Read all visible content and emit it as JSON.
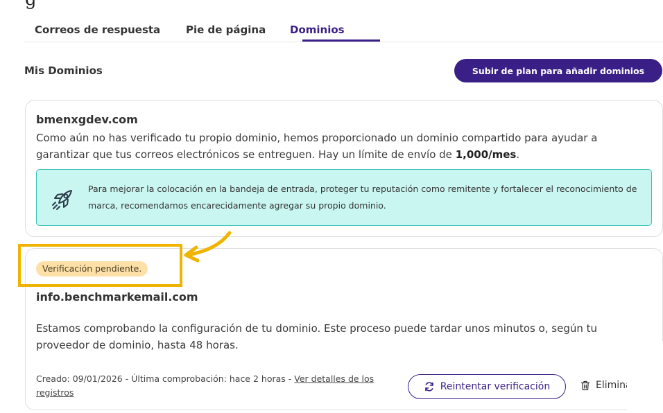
{
  "tabs": [
    {
      "label": "Correos de respuesta",
      "active": false
    },
    {
      "label": "Pie de página",
      "active": false
    },
    {
      "label": "Dominios",
      "active": true
    }
  ],
  "section": {
    "title": "Mis Dominios",
    "upgrade_button": "Subir de plan para añadir dominios"
  },
  "shared_domain": {
    "name": "bmenxgdev.com",
    "description": "Como aún no has verificado tu propio dominio, hemos proporcionado un dominio compartido para ayudar a garantizar que tus correos electrónicos se entreguen. Hay un límite de envío de ",
    "limit": "1,000/mes",
    "period": ".",
    "info_icon": "rocket-icon",
    "info_text": "Para mejorar la colocación en la bandeja de entrada, proteger tu reputación como remitente y fortalecer el reconocimiento de marca, recomendamos encarecidamente agregar su propio dominio."
  },
  "pending_domain": {
    "status_badge": "Verificación pendiente.",
    "name": "info.benchmarkemail.com",
    "description": "Estamos comprobando la configuración de tu dominio. Este proceso puede tardar unos minutos o, según tu proveedor de dominio, hasta 48 horas.",
    "created_meta": "Creado: 09/01/2026 - Última comprobación: hace 2 horas - ",
    "details_link": "Ver detalles de los registros",
    "retry_button": "Reintentar verificación",
    "retry_icon": "refresh-icon",
    "delete_button": "Eliminar",
    "delete_icon": "trash-icon"
  },
  "colors": {
    "accent": "#3a1f86",
    "info_bg": "#c9f6f1",
    "info_border": "#39c3b8",
    "badge_bg": "#fce0a8",
    "annotation": "#f0b400"
  }
}
